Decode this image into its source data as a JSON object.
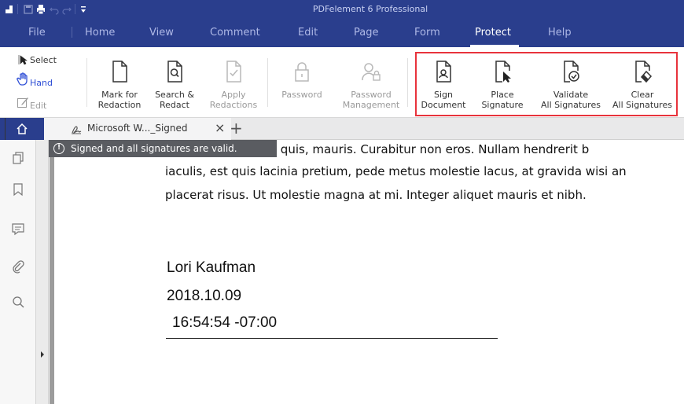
{
  "titlebar": {
    "title": "PDFelement 6 Professional",
    "quick_access": [
      "logo-icon",
      "save-icon",
      "print-icon",
      "undo-icon",
      "redo-icon",
      "customize-icon"
    ]
  },
  "menu": {
    "items": [
      {
        "label": "File"
      },
      {
        "label": "Home"
      },
      {
        "label": "View"
      },
      {
        "label": "Comment"
      },
      {
        "label": "Edit"
      },
      {
        "label": "Page"
      },
      {
        "label": "Form"
      },
      {
        "label": "Protect",
        "active": true
      },
      {
        "label": "Help"
      }
    ]
  },
  "ribbon": {
    "modes": [
      {
        "label": "Select",
        "icon": "cursor-icon"
      },
      {
        "label": "Hand",
        "icon": "hand-icon"
      },
      {
        "label": "Edit",
        "icon": "edit-icon"
      }
    ],
    "buttons": [
      {
        "label1": "Mark for",
        "label2": "Redaction",
        "icon": "mark-redaction-icon",
        "enabled": true
      },
      {
        "label1": "Search &",
        "label2": "Redact",
        "icon": "search-redact-icon",
        "enabled": true
      },
      {
        "label1": "Apply",
        "label2": "Redactions",
        "icon": "apply-redactions-icon",
        "enabled": false
      },
      {
        "label1": "Password",
        "label2": "",
        "icon": "lock-icon",
        "enabled": false
      },
      {
        "label1": "Password",
        "label2": "Management",
        "icon": "password-management-icon",
        "enabled": false
      },
      {
        "label1": "Sign",
        "label2": "Document",
        "icon": "sign-document-icon",
        "enabled": true
      },
      {
        "label1": "Place",
        "label2": "Signature",
        "icon": "place-signature-icon",
        "enabled": true
      },
      {
        "label1": "Validate",
        "label2": "All Signatures",
        "icon": "validate-signatures-icon",
        "enabled": true
      },
      {
        "label1": "Clear",
        "label2": "All Signatures",
        "icon": "clear-signatures-icon",
        "enabled": true
      }
    ],
    "highlight_color": "#e8333c"
  },
  "tabs": {
    "doc_title": "Microsoft W..._Signed",
    "close_glyph": "×",
    "add_glyph": "+"
  },
  "sidebar": {
    "icons": [
      "thumbnails-icon",
      "bookmark-icon",
      "comment-icon",
      "attachment-icon",
      "search-icon"
    ]
  },
  "notice": {
    "icon_glyph": "!",
    "text": "Signed and all signatures are valid."
  },
  "document": {
    "lines": [
      "aget, egestas quis, mauris. Curabitur non eros. Nullam hendrerit b",
      "iaculis, est quis lacinia pretium, pede metus molestie lacus, at gravida wisi an",
      "placerat risus. Ut molestie magna at mi. Integer aliquet mauris et nibh."
    ],
    "signature": {
      "name": "Lori Kaufman",
      "date": "2018.10.09",
      "time": "16:54:54 -07:00"
    }
  },
  "colors": {
    "titlebar_bg": "#2a3e8d",
    "notice_bg": "#5a5c61",
    "accent": "#2a3e8d"
  }
}
